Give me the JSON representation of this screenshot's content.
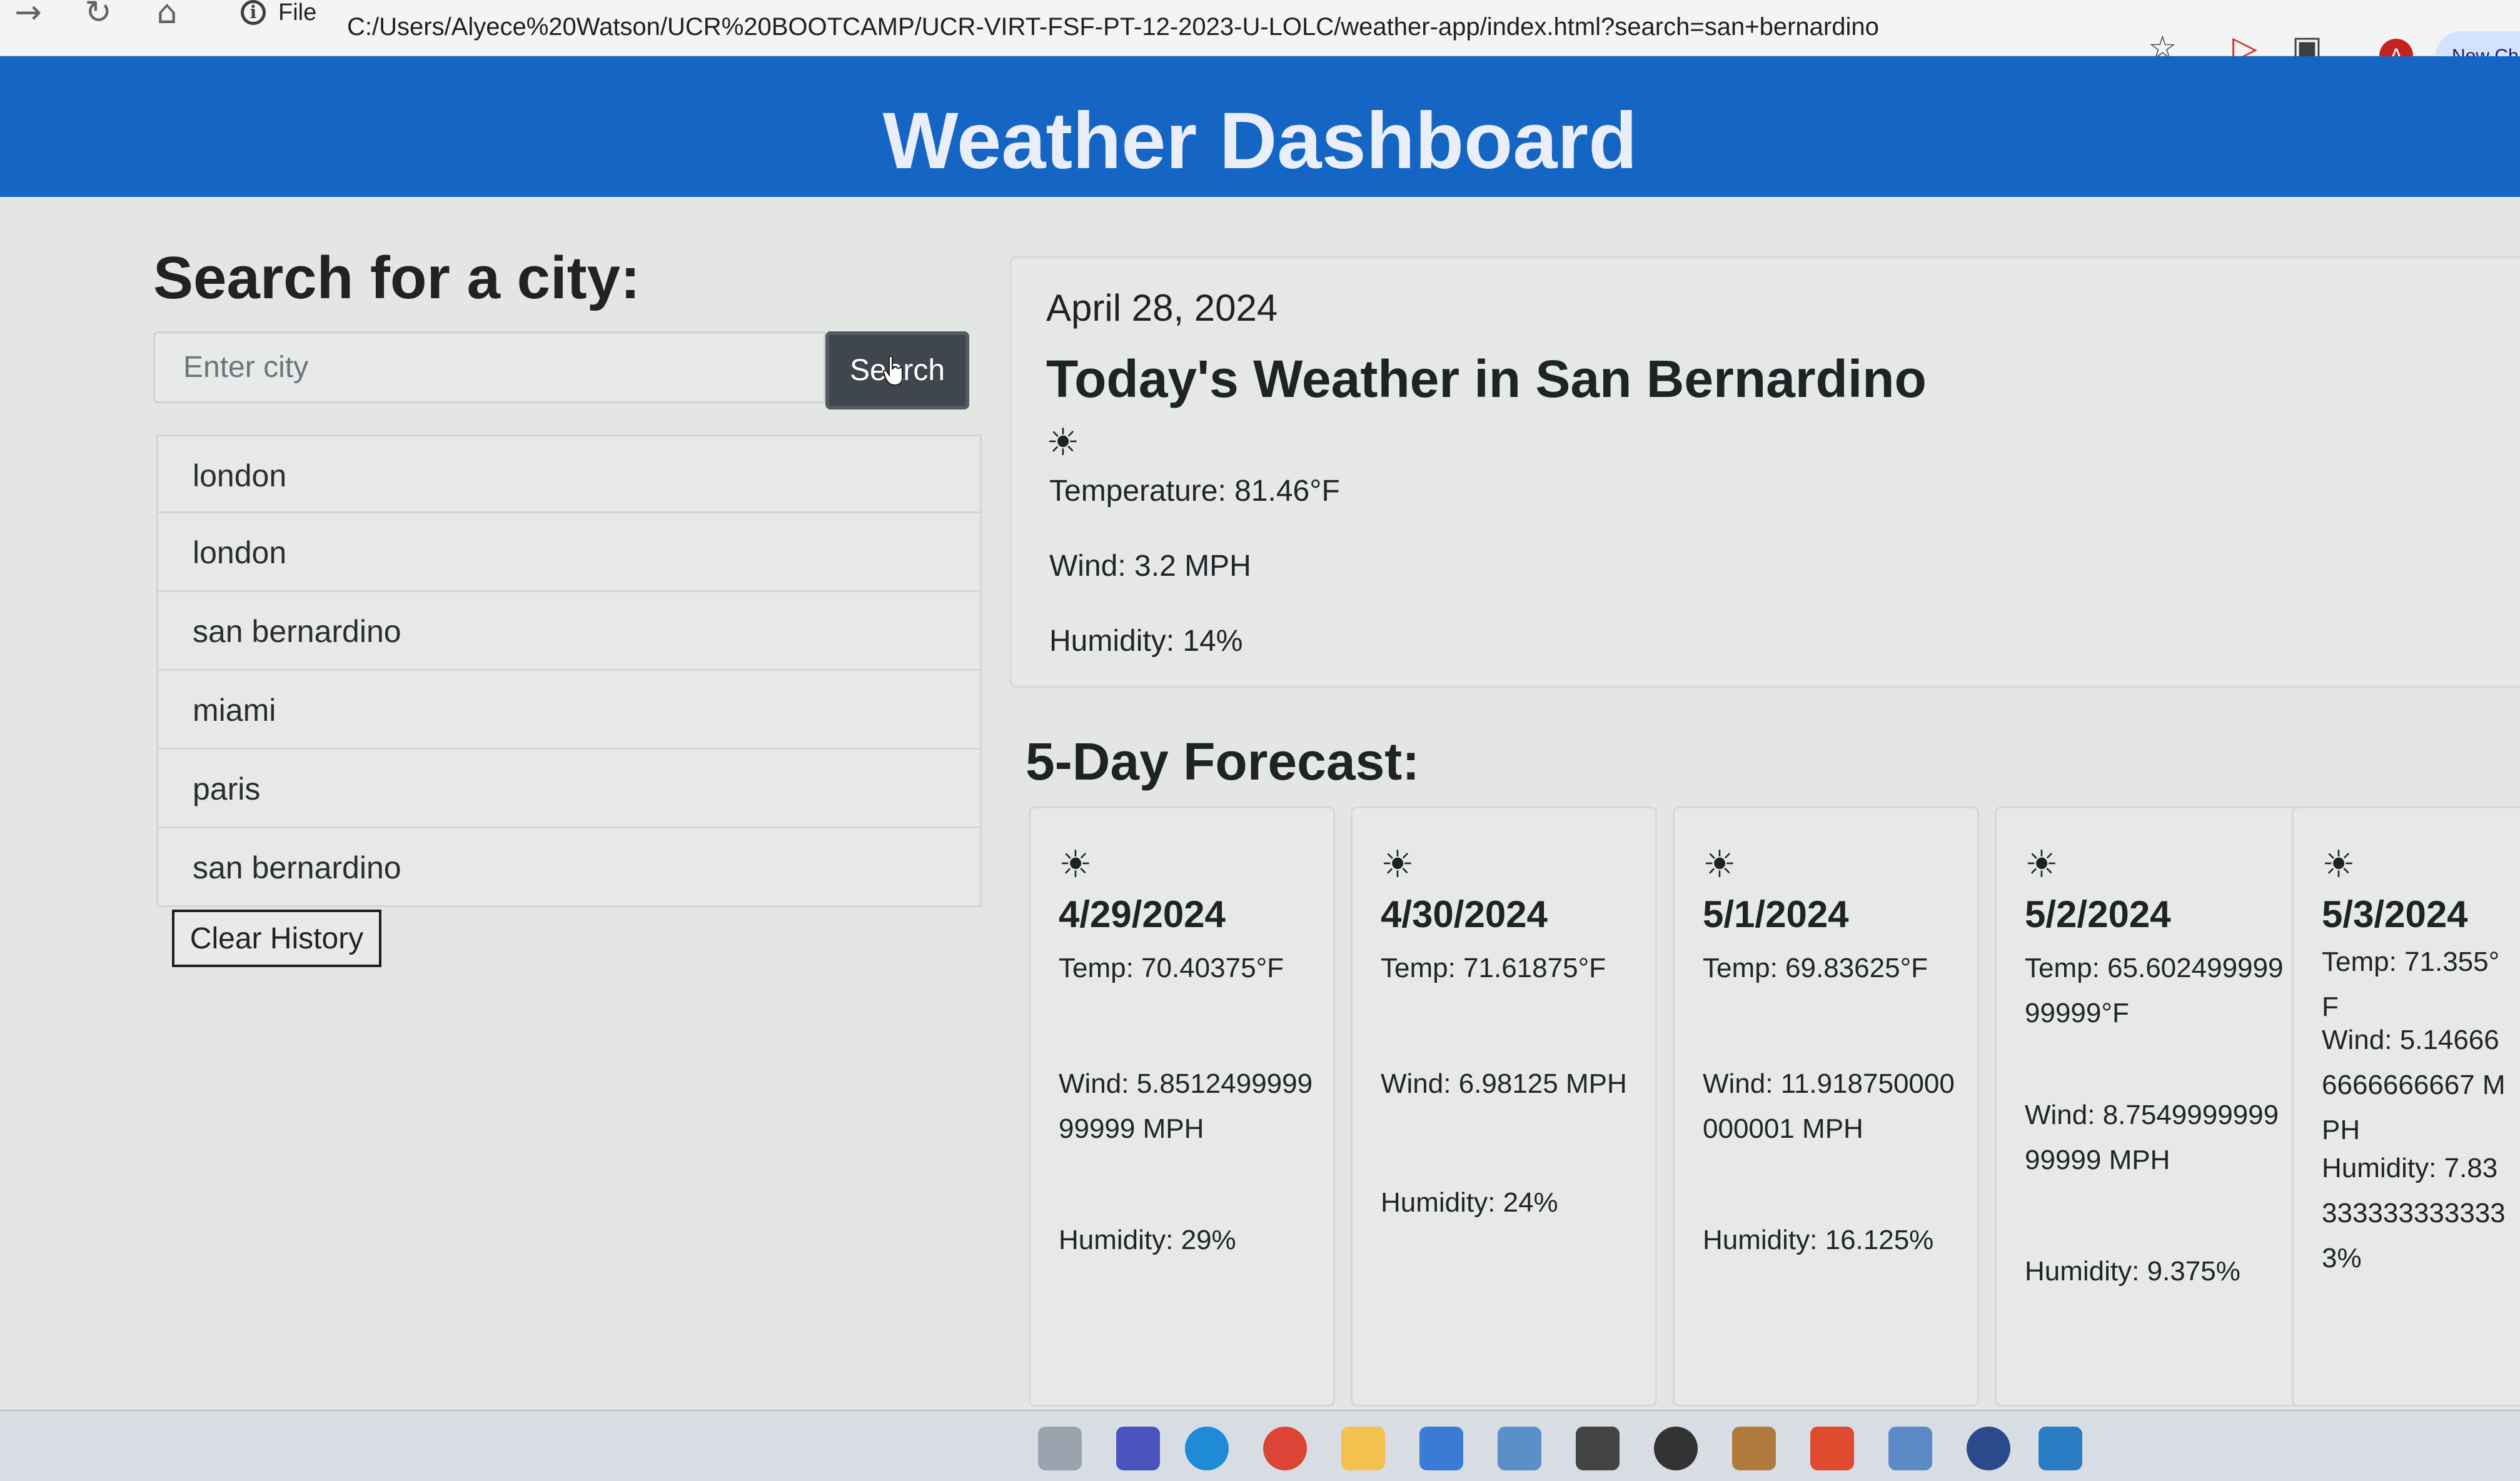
{
  "browser": {
    "url": "C:/Users/Alyece%20Watson/UCR%20BOOTCAMP/UCR-VIRT-FSF-PT-12-2023-U-LOLC/weather-app/index.html?search=san+bernardino",
    "file_label": "File",
    "profile_initial": "A",
    "new_chrome_label": "New Ch"
  },
  "header": {
    "title": "Weather Dashboard"
  },
  "search": {
    "heading": "Search for a city:",
    "placeholder": "Enter city",
    "button_label": "Search"
  },
  "history": {
    "items": [
      "london",
      "london",
      "san bernardino",
      "miami",
      "paris",
      "san bernardino"
    ],
    "clear_label": "Clear History"
  },
  "current": {
    "date": "April 28, 2024",
    "title": "Today's Weather in San Bernardino",
    "icon": "sun-icon",
    "temperature": "Temperature: 81.46°F",
    "wind": "Wind: 3.2 MPH",
    "humidity": "Humidity: 14%"
  },
  "forecast": {
    "heading": "5-Day Forecast:",
    "days": [
      {
        "date": "4/29/2024",
        "temp": "Temp: 70.40375°F",
        "wind": "Wind: 5.851249999999999 MPH",
        "humidity": "Humidity: 29%"
      },
      {
        "date": "4/30/2024",
        "temp": "Temp: 71.61875°F",
        "wind": "Wind: 6.98125 MPH",
        "humidity": "Humidity: 24%"
      },
      {
        "date": "5/1/2024",
        "temp": "Temp: 69.83625°F",
        "wind": "Wind: 11.918750000000001 MPH",
        "humidity": "Humidity: 16.125%"
      },
      {
        "date": "5/2/2024",
        "temp": "Temp: 65.60249999999999°F",
        "wind": "Wind: 8.754999999999999 MPH",
        "humidity": "Humidity: 9.375%"
      },
      {
        "date": "5/3/2024",
        "temp": "Temp: 71.355°F",
        "wind": "Wind: 5.146666666666667 MPH",
        "humidity": "Humidity: 7.833333333333333%"
      }
    ]
  },
  "colors": {
    "header_blue": "#1565c4",
    "search_button": "#3f464d",
    "page_background": "#e4e6e4"
  }
}
